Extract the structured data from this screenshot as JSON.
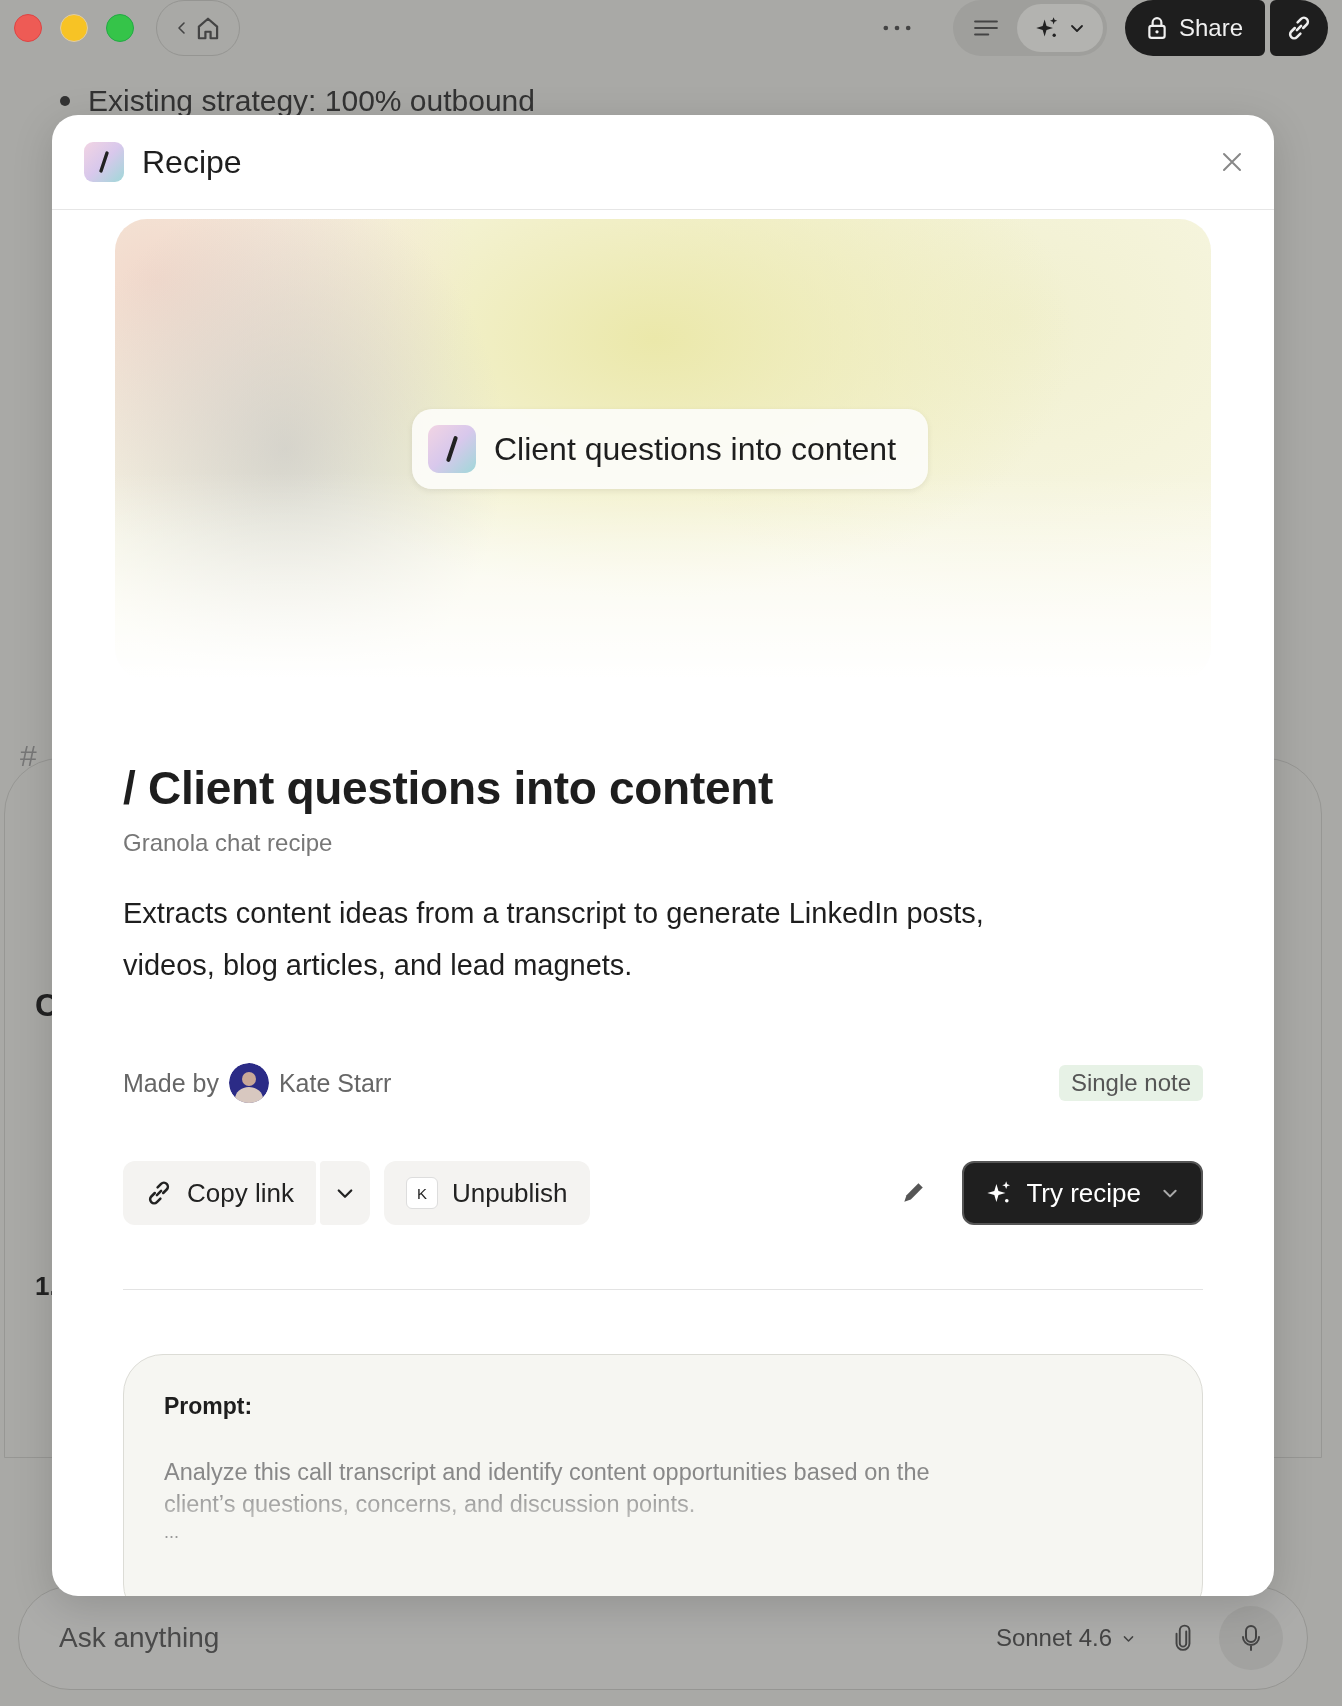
{
  "toolbar": {
    "share_label": "Share",
    "view_modes": [
      {
        "kind": "list",
        "selected": false
      },
      {
        "kind": "ai",
        "selected": true
      }
    ]
  },
  "background": {
    "bullet": "Existing strategy: 100% outbound",
    "fragments": [
      "#",
      "C",
      "1."
    ]
  },
  "dialog": {
    "title": "Recipe",
    "banner_chip": "Client questions into content",
    "heading": "/ Client questions into content",
    "subtitle": "Granola chat recipe",
    "description": "Extracts content ideas from a transcript to generate LinkedIn posts, videos, blog articles, and lead magnets.",
    "made_by_label": "Made by",
    "author": "Kate Starr",
    "tag": "Single note",
    "actions": {
      "copy_link": "Copy link",
      "unpublish_key": "K",
      "unpublish": "Unpublish",
      "try": "Try recipe"
    },
    "prompt": {
      "label": "Prompt:",
      "text": "Analyze this call transcript and identify content opportunities based on the client’s questions, concerns, and discussion points.",
      "more": "..."
    }
  },
  "composer": {
    "placeholder": "Ask anything",
    "model": "Sonnet 4.6"
  }
}
